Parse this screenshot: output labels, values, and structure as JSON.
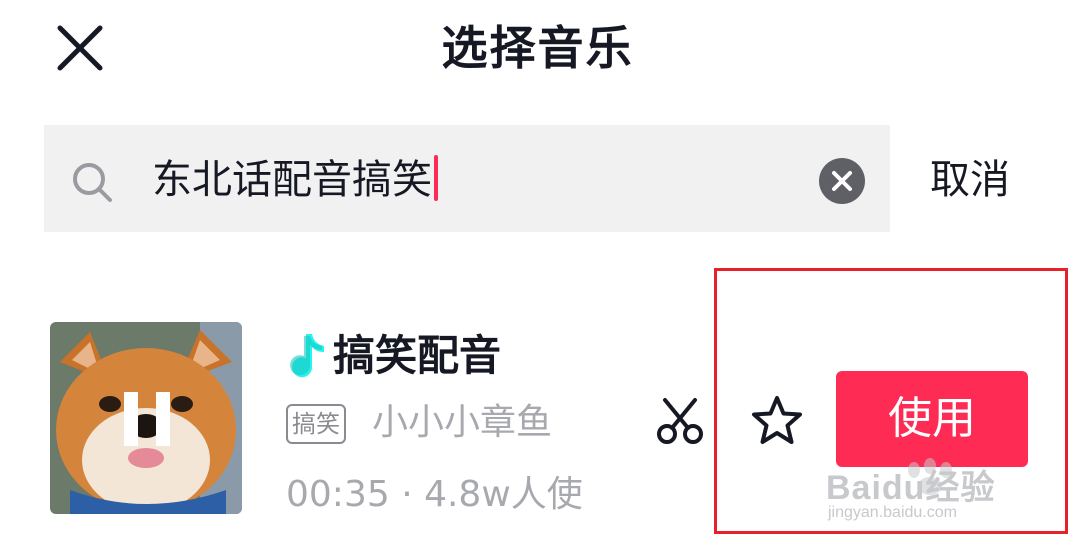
{
  "header": {
    "title": "选择音乐",
    "close_icon": "close-icon"
  },
  "search": {
    "query": "东北话配音搞笑",
    "search_icon": "search-icon",
    "clear_icon": "clear-icon",
    "cancel_label": "取消",
    "caret_color": "#fe2c55"
  },
  "result": {
    "title": "搞笑配音",
    "tag": "搞笑",
    "author": "小小小章鱼",
    "meta": "00:35 · 4.8w人使",
    "use_label": "使用",
    "use_color": "#fe2c55",
    "icons": [
      "music-note-icon",
      "pause-icon",
      "scissors-icon",
      "star-icon"
    ]
  },
  "watermark": {
    "brand": "Baidu经验",
    "url": "jingyan.baidu.com"
  }
}
